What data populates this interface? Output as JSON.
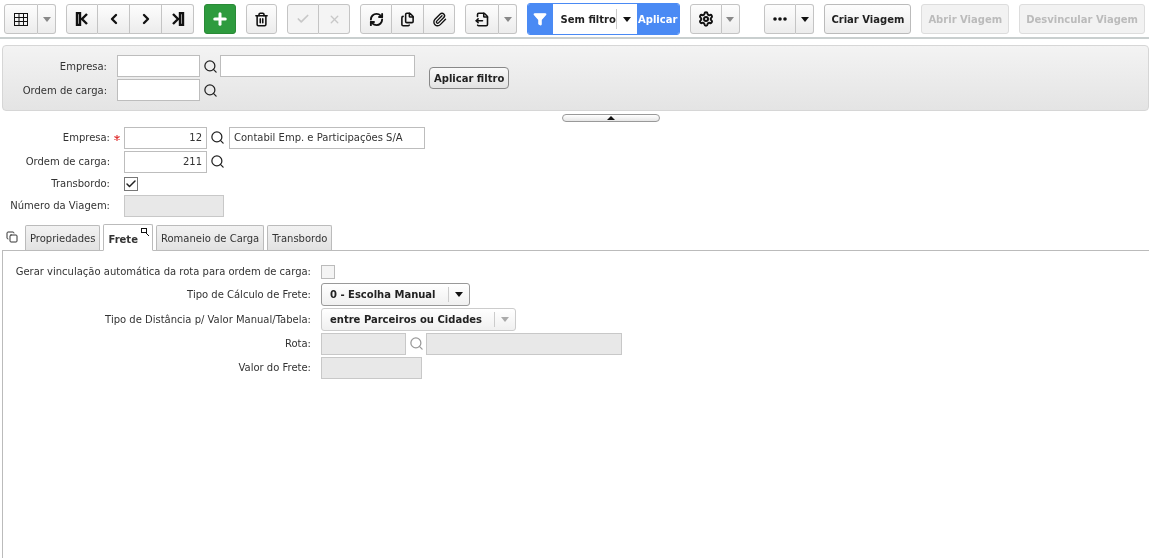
{
  "toolbar": {
    "icon_groups": [
      [
        {
          "kind": "grid",
          "disabled": false
        },
        {
          "kind": "caret",
          "disabled": false
        }
      ],
      [
        {
          "kind": "first",
          "disabled": false
        },
        {
          "kind": "prev",
          "disabled": false
        },
        {
          "kind": "next",
          "disabled": false
        },
        {
          "kind": "last",
          "disabled": false
        }
      ],
      [
        {
          "kind": "add",
          "disabled": false
        }
      ],
      [
        {
          "kind": "delete",
          "disabled": false
        }
      ],
      [
        {
          "kind": "confirm",
          "disabled": true
        },
        {
          "kind": "cancel",
          "disabled": true
        }
      ],
      [
        {
          "kind": "refresh",
          "disabled": false
        },
        {
          "kind": "duplicate",
          "disabled": false
        },
        {
          "kind": "attach",
          "disabled": false
        }
      ],
      [
        {
          "kind": "export",
          "disabled": false
        },
        {
          "kind": "caret",
          "disabled": false
        }
      ]
    ],
    "filter": {
      "value": "Sem filtro",
      "apply": "Aplicar"
    },
    "settings_group": [
      {
        "kind": "settings",
        "disabled": false
      },
      {
        "kind": "caret",
        "disabled": false
      }
    ],
    "more_group": [
      {
        "kind": "more",
        "disabled": false
      },
      {
        "kind": "dark-caret",
        "disabled": false
      }
    ],
    "actions": [
      {
        "label": "Criar Viagem",
        "disabled": false
      },
      {
        "label": "Abrir Viagem",
        "disabled": true
      },
      {
        "label": "Desvincular Viagem",
        "disabled": true
      }
    ]
  },
  "filter_panel": {
    "fields": [
      {
        "label": "Empresa:",
        "kind": "lookup_with_name"
      },
      {
        "label": "Ordem de carga:",
        "kind": "lookup"
      }
    ],
    "button": "Aplicar filtro"
  },
  "form": {
    "fields": [
      {
        "label": "Empresa:",
        "kind": "lookup",
        "required": true,
        "value": "12",
        "name": "Contabil Emp. e Participações S/A"
      },
      {
        "label": "Ordem de carga:",
        "kind": "lookup",
        "required": false,
        "value": "211"
      },
      {
        "label": "Transbordo:",
        "kind": "checkbox",
        "required": false,
        "checked": true
      },
      {
        "label": "Número da Viagem:",
        "kind": "text",
        "required": false,
        "disabled": true
      }
    ]
  },
  "tabs": [
    {
      "label": "Propriedades",
      "selected": false
    },
    {
      "label": "Frete",
      "selected": true
    },
    {
      "label": "Romaneio de Carga",
      "selected": false
    },
    {
      "label": "Transbordo",
      "selected": false
    }
  ],
  "frete": {
    "fields": [
      {
        "label": "Gerar vinculação automática da rota para ordem de carga:",
        "kind": "checkbox",
        "checked": false
      },
      {
        "label": "Tipo de Cálculo de Frete:",
        "kind": "select",
        "value": "0 - Escolha Manual",
        "disabled": false
      },
      {
        "label": "Tipo de Distância p/ Valor Manual/Tabela:",
        "kind": "select",
        "value": "entre Parceiros ou Cidades",
        "disabled": true
      },
      {
        "label": "Rota:",
        "kind": "lookup",
        "disabled": true
      },
      {
        "label": "Valor do Frete:",
        "kind": "text",
        "disabled": true
      }
    ]
  }
}
